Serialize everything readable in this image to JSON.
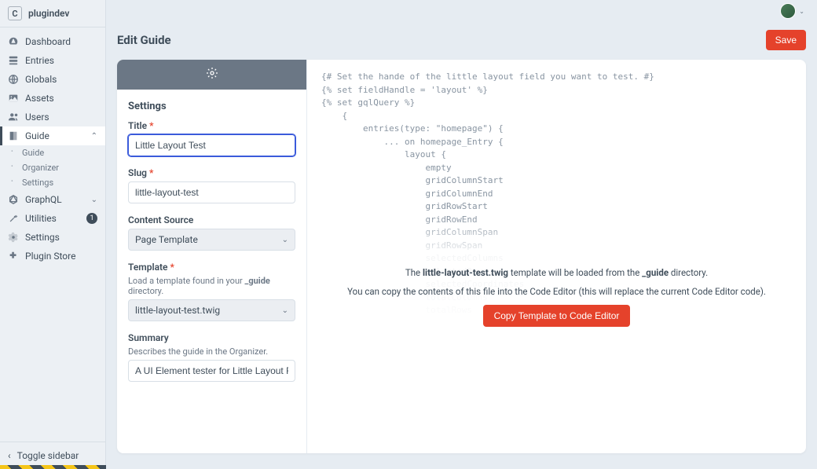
{
  "brand": {
    "logo_letter": "C",
    "name": "plugindev"
  },
  "nav": {
    "items": [
      {
        "label": "Dashboard",
        "icon": "dashboard-icon"
      },
      {
        "label": "Entries",
        "icon": "entries-icon"
      },
      {
        "label": "Globals",
        "icon": "globals-icon"
      },
      {
        "label": "Assets",
        "icon": "assets-icon"
      },
      {
        "label": "Users",
        "icon": "users-icon"
      },
      {
        "label": "Guide",
        "icon": "guide-icon",
        "expanded": true,
        "active": true,
        "sub": [
          {
            "label": "Guide"
          },
          {
            "label": "Organizer"
          },
          {
            "label": "Settings"
          }
        ]
      },
      {
        "label": "GraphQL",
        "icon": "graphql-icon",
        "chevron": true
      },
      {
        "label": "Utilities",
        "icon": "utilities-icon",
        "badge": "1"
      },
      {
        "label": "Settings",
        "icon": "settings-icon"
      },
      {
        "label": "Plugin Store",
        "icon": "plugin-icon"
      }
    ],
    "toggle_sidebar": "Toggle sidebar"
  },
  "page": {
    "title": "Edit Guide",
    "save_label": "Save"
  },
  "settings": {
    "heading": "Settings",
    "fields": {
      "title": {
        "label": "Title",
        "required": true,
        "value": "Little Layout Test"
      },
      "slug": {
        "label": "Slug",
        "required": true,
        "value": "little-layout-test"
      },
      "content_source": {
        "label": "Content Source",
        "value": "Page Template"
      },
      "template": {
        "label": "Template",
        "required": true,
        "help_pre": "Load a template found in your ",
        "help_bold": "_guide",
        "help_post": " directory.",
        "value": "little-layout-test.twig"
      },
      "summary": {
        "label": "Summary",
        "help": "Describes the guide in the Organizer.",
        "value": "A UI Element tester for Little Layout Fields"
      }
    }
  },
  "editor": {
    "code": "{# Set the hande of the little layout field you want to test. #}\n{% set fieldHandle = 'layout' %}\n{% set gqlQuery %}\n    {\n        entries(type: \"homepage\") {\n            ... on homepage_Entry {\n                layout {\n                    empty\n                    gridColumnStart\n                    gridColumnEnd\n                    gridRowStart\n                    gridRowEnd\n                    gridColumnSpan\n                    gridRowSpan\n                    selectedColumns\n                    selectedRows\n                    selectedCoordinates\n                    totalColumns\n                    totalRows",
    "overlay": {
      "line1_pre": "The ",
      "line1_bold1": "little-layout-test.twig",
      "line1_mid": " template will be loaded from the ",
      "line1_bold2": "_guide",
      "line1_post": " directory.",
      "line2": "You can copy the contents of this file into the Code Editor (this will replace the current Code Editor code).",
      "button": "Copy Template to Code Editor"
    }
  }
}
